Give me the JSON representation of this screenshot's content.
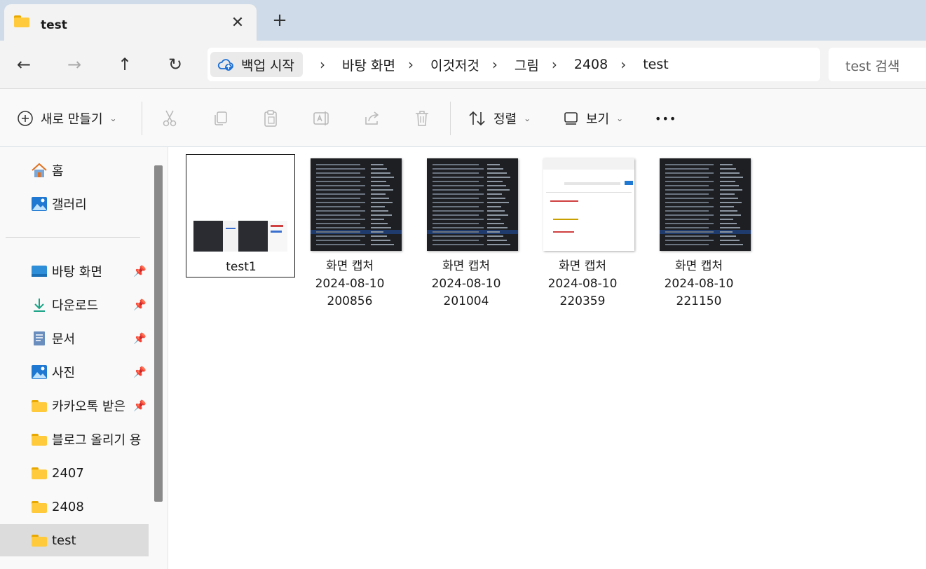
{
  "tab": {
    "title": "test",
    "close": "✕",
    "new": "+"
  },
  "nav": {
    "back": "←",
    "forward": "→",
    "up": "↑",
    "refresh": "↻",
    "root_label": "백업 시작",
    "breadcrumbs": [
      "바탕 화면",
      "이것저것",
      "그림",
      "2408",
      "test"
    ],
    "chevron": "›",
    "search_placeholder": "test 검색"
  },
  "commands": {
    "new_label": "새로 만들기",
    "sort_label": "정렬",
    "view_label": "보기",
    "more": "•••",
    "caret": "⌄"
  },
  "sidebar": {
    "top": [
      {
        "label": "홈",
        "icon": "home-icon"
      },
      {
        "label": "갤러리",
        "icon": "gallery-icon"
      }
    ],
    "items": [
      {
        "label": "바탕 화면",
        "icon": "desktop-icon",
        "pinned": true
      },
      {
        "label": "다운로드",
        "icon": "download-icon",
        "pinned": true
      },
      {
        "label": "문서",
        "icon": "document-icon",
        "pinned": true
      },
      {
        "label": "사진",
        "icon": "pictures-icon",
        "pinned": true
      },
      {
        "label": "카카오톡 받은",
        "icon": "folder-icon",
        "pinned": true
      },
      {
        "label": "블로그 올리기 용",
        "icon": "folder-icon",
        "pinned": false
      },
      {
        "label": "2407",
        "icon": "folder-icon",
        "pinned": false
      },
      {
        "label": "2408",
        "icon": "folder-icon",
        "pinned": false
      },
      {
        "label": "test",
        "icon": "folder-icon",
        "pinned": false,
        "active": true
      }
    ]
  },
  "files": [
    {
      "name": "test1",
      "selected": true
    },
    {
      "name": "화면 캡처\n2024-08-10\n200856"
    },
    {
      "name": "화면 캡처\n2024-08-10\n201004"
    },
    {
      "name": "화면 캡처\n2024-08-10\n220359"
    },
    {
      "name": "화면 캡처\n2024-08-10\n221150"
    }
  ],
  "colors": {
    "tabstrip": "#cfdbe9",
    "folder": "#ffcb3d",
    "active_item": "#dcdcdc"
  }
}
